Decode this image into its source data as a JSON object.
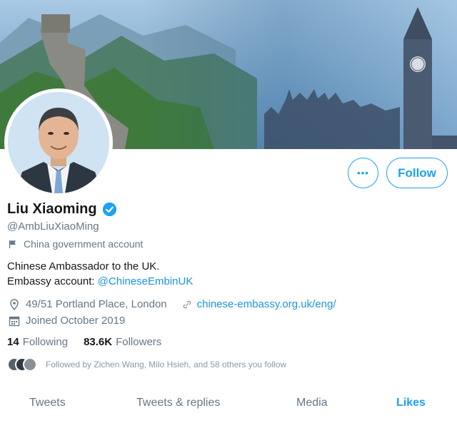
{
  "profile": {
    "name": "Liu Xiaoming",
    "handle": "@AmbLiuXiaoMing",
    "government_label": "China government account",
    "bio_line1": "Chinese Ambassador to the UK.",
    "bio_line2_prefix": "Embassy account: ",
    "bio_line2_link": "@ChineseEmbinUK",
    "location": "49/51 Portland Place, London",
    "website": "chinese-embassy.org.uk/eng/",
    "joined": "Joined October 2019",
    "following_count": "14",
    "following_label": "Following",
    "followers_count": "83.6K",
    "followers_label": "Followers",
    "followed_by": "Followed by Zichen Wang, Milo Hsieh, and 58 others you follow"
  },
  "actions": {
    "more_label": "•••",
    "follow_label": "Follow"
  },
  "tabs": [
    {
      "label": "Tweets",
      "active": false
    },
    {
      "label": "Tweets & replies",
      "active": false
    },
    {
      "label": "Media",
      "active": false
    },
    {
      "label": "Likes",
      "active": true
    }
  ],
  "icons": {
    "verified": "verified-badge-icon",
    "government": "flag-icon",
    "location": "location-pin-icon",
    "website": "link-icon",
    "joined": "calendar-icon",
    "more": "more-icon"
  },
  "colors": {
    "accent": "#1da1f2",
    "link": "#1b95e0",
    "text_primary": "#14171a",
    "text_secondary": "#657786"
  }
}
